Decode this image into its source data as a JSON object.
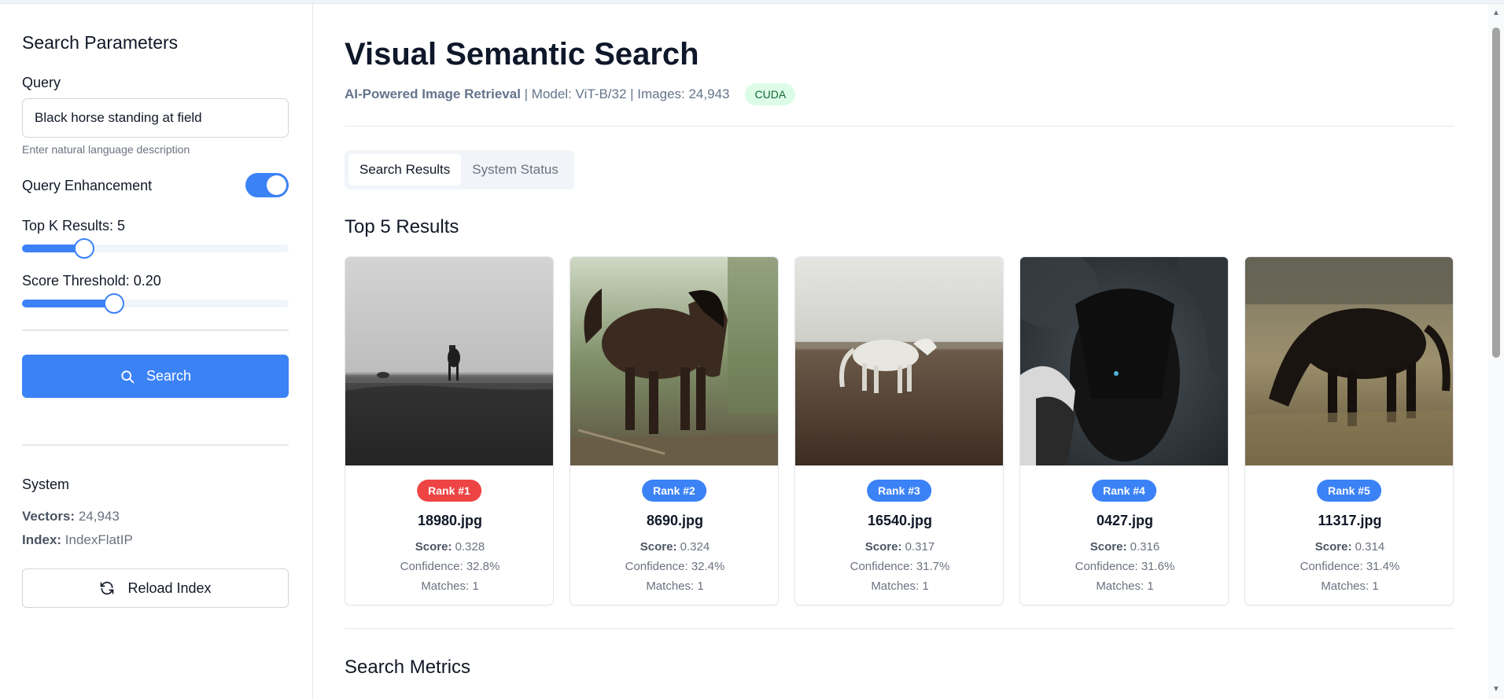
{
  "sidebar": {
    "title": "Search Parameters",
    "query_label": "Query",
    "query_value": "Black horse standing at field",
    "query_hint": "Enter natural language description",
    "enhancement_label": "Query Enhancement",
    "enhancement_on": true,
    "topk_label": "Top K Results: 5",
    "topk_value": 5,
    "threshold_label": "Score Threshold: 0.20",
    "threshold_value": 0.2,
    "search_label": "Search",
    "system_title": "System",
    "vectors_key": "Vectors:",
    "vectors_value": "24,943",
    "index_key": "Index:",
    "index_value": "IndexFlatIP",
    "reload_label": "Reload Index"
  },
  "header": {
    "title": "Visual Semantic Search",
    "subtitle_strong": "AI-Powered Image Retrieval",
    "subtitle_rest": " | Model: ViT-B/32 | Images: 24,943",
    "device_badge": "CUDA"
  },
  "tabs": [
    {
      "label": "Search Results",
      "active": true
    },
    {
      "label": "System Status",
      "active": false
    }
  ],
  "results_title": "Top 5 Results",
  "metrics_title": "Search Metrics",
  "results": [
    {
      "rank": "Rank #1",
      "file": "18980.jpg",
      "score_key": "Score:",
      "score": "0.328",
      "confidence": "Confidence: 32.8%",
      "matches": "Matches: 1",
      "badge_color": "#ef4444"
    },
    {
      "rank": "Rank #2",
      "file": "8690.jpg",
      "score_key": "Score:",
      "score": "0.324",
      "confidence": "Confidence: 32.4%",
      "matches": "Matches: 1",
      "badge_color": "#3b82f6"
    },
    {
      "rank": "Rank #3",
      "file": "16540.jpg",
      "score_key": "Score:",
      "score": "0.317",
      "confidence": "Confidence: 31.7%",
      "matches": "Matches: 1",
      "badge_color": "#3b82f6"
    },
    {
      "rank": "Rank #4",
      "file": "0427.jpg",
      "score_key": "Score:",
      "score": "0.316",
      "confidence": "Confidence: 31.6%",
      "matches": "Matches: 1",
      "badge_color": "#3b82f6"
    },
    {
      "rank": "Rank #5",
      "file": "11317.jpg",
      "score_key": "Score:",
      "score": "0.314",
      "confidence": "Confidence: 31.4%",
      "matches": "Matches: 1",
      "badge_color": "#3b82f6"
    }
  ],
  "colors": {
    "accent": "#3b82f6",
    "rank1": "#ef4444",
    "cuda_bg": "#dcfce7"
  }
}
